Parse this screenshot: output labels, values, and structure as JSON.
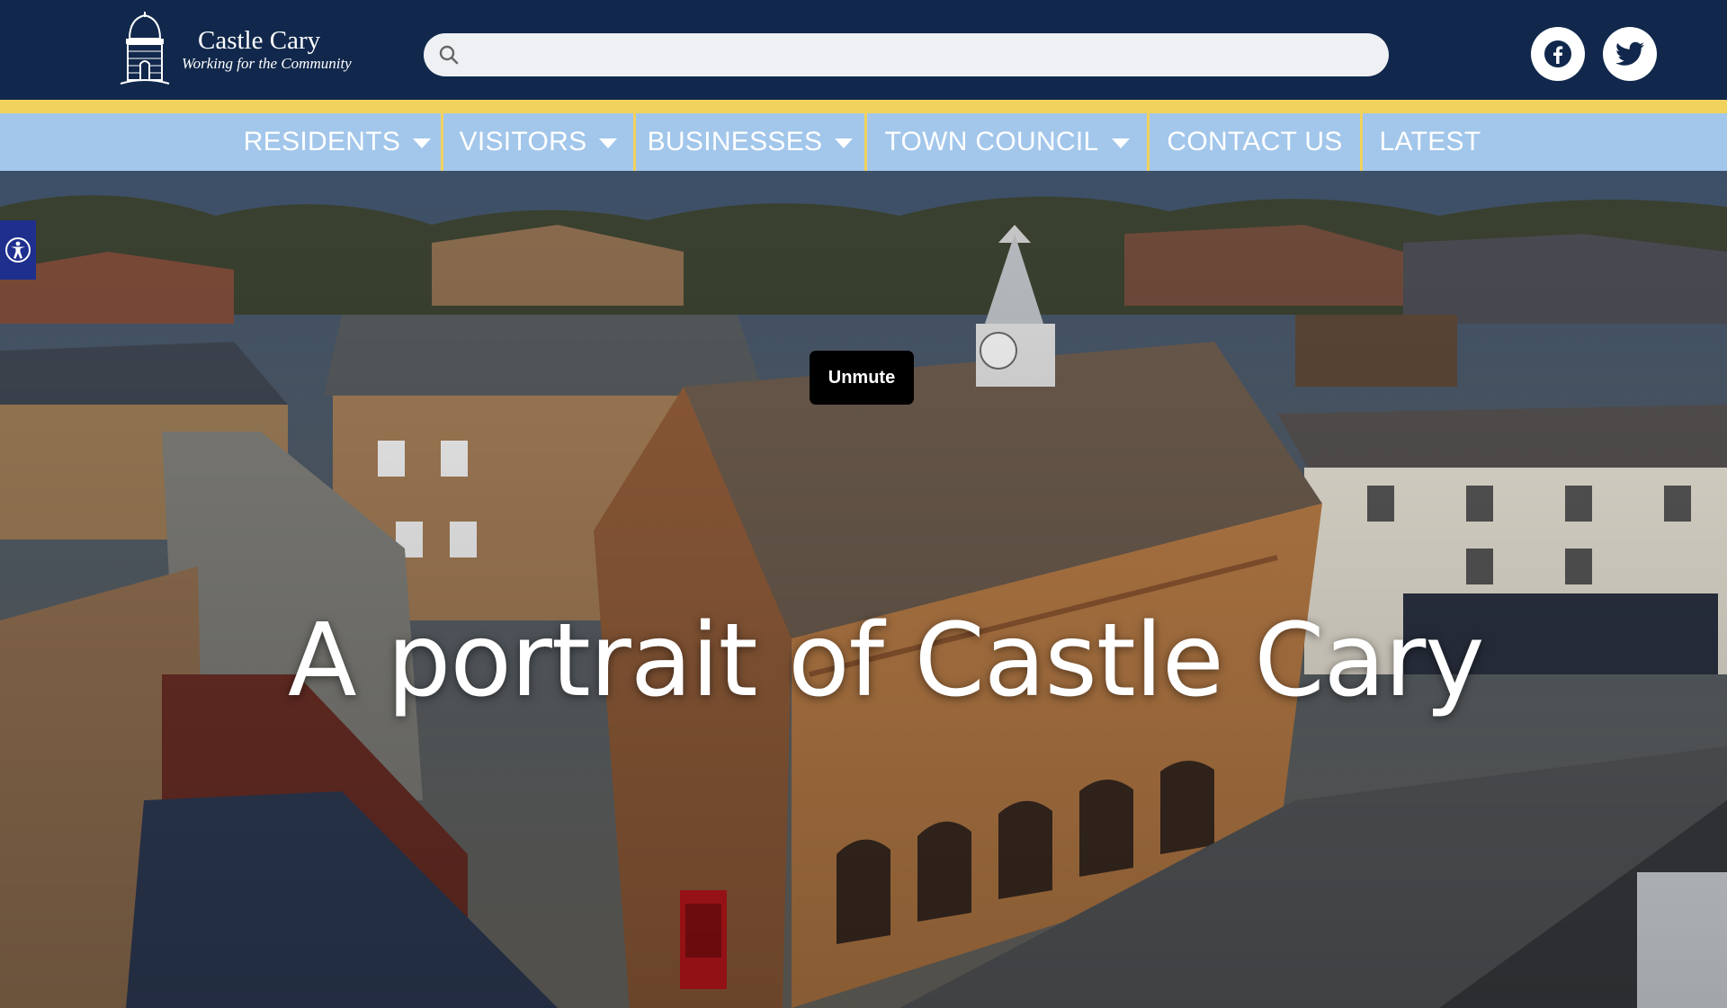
{
  "site": {
    "name": "Castle Cary",
    "tagline": "Working for the Community"
  },
  "search": {
    "value": "",
    "placeholder": ""
  },
  "social": {
    "facebook_icon": "facebook-icon",
    "twitter_icon": "twitter-icon"
  },
  "nav": {
    "items": [
      {
        "label": "RESIDENTS",
        "has_dropdown": true
      },
      {
        "label": "VISITORS",
        "has_dropdown": true
      },
      {
        "label": "BUSINESSES",
        "has_dropdown": true
      },
      {
        "label": "TOWN COUNCIL",
        "has_dropdown": true
      },
      {
        "label": "CONTACT US",
        "has_dropdown": false
      },
      {
        "label": "LATEST",
        "has_dropdown": false
      }
    ]
  },
  "hero": {
    "title": "A portrait of Castle Cary",
    "unmute_label": "Unmute"
  },
  "accessibility": {
    "icon": "accessibility-icon"
  },
  "colors": {
    "header_bg": "#11284c",
    "accent_gold": "#f1d25c",
    "nav_bg": "#a3c7eb"
  }
}
